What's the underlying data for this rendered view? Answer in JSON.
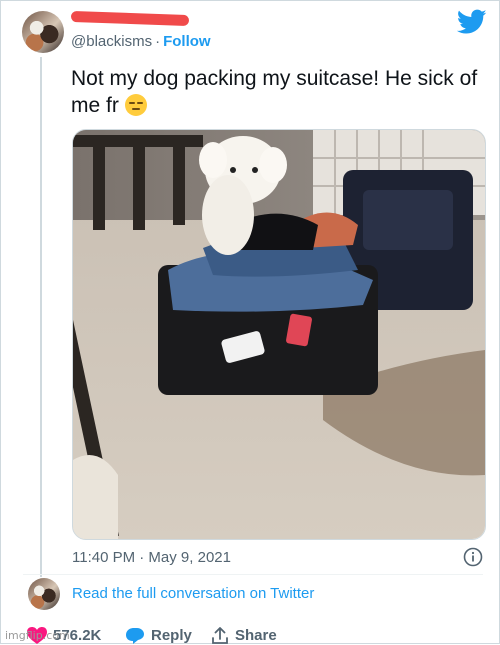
{
  "author": {
    "handle": "@blackisms",
    "separator": "·",
    "follow_label": "Follow"
  },
  "tweet": {
    "text": "Not my dog packing my suitcase! He sick of me fr",
    "emoji": "pensive-face-emoji",
    "timestamp": "11:40 PM · May 9, 2021"
  },
  "footer": {
    "read_full_label": "Read the full conversation on Twitter",
    "likes_count": "576.2K",
    "reply_label": "Reply",
    "share_label": "Share"
  },
  "watermark": "imgflip.com",
  "colors": {
    "twitter_blue": "#1d9bf0",
    "secondary_text": "#536471",
    "like_red": "#f91880",
    "redaction_red": "#f04a4a"
  },
  "icons": [
    "twitter-bird-icon",
    "info-icon",
    "heart-icon",
    "reply-bubble-icon",
    "share-icon"
  ]
}
